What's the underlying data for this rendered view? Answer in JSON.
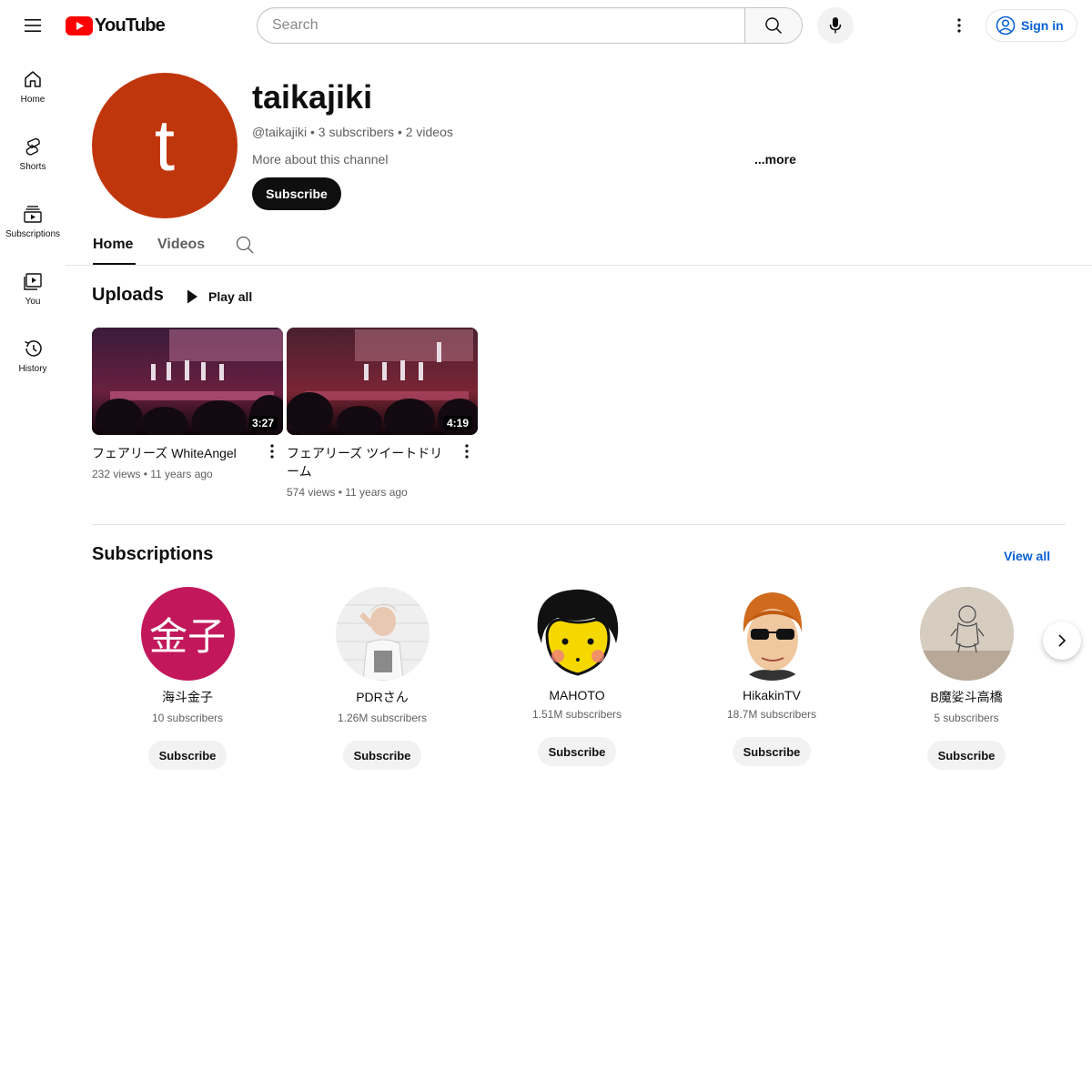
{
  "topbar": {
    "logo_text": "YouTube",
    "search_placeholder": "Search",
    "signin_label": "Sign in"
  },
  "sidebar": {
    "items": [
      {
        "label": "Home",
        "icon": "home-icon"
      },
      {
        "label": "Shorts",
        "icon": "shorts-icon"
      },
      {
        "label": "Subscriptions",
        "icon": "subscriptions-icon"
      },
      {
        "label": "You",
        "icon": "you-icon"
      },
      {
        "label": "History",
        "icon": "history-icon"
      }
    ]
  },
  "channel": {
    "avatar_letter": "t",
    "avatar_color": "#c0360c",
    "name": "taikajiki",
    "meta": "@taikajiki • 3 subscribers • 2 videos",
    "about": "More about this channel",
    "more": "...more",
    "subscribe_label": "Subscribe"
  },
  "tabs": {
    "home": "Home",
    "videos": "Videos"
  },
  "uploads": {
    "title": "Uploads",
    "play_all": "Play all",
    "videos": [
      {
        "title": "フェアリーズ WhiteAngel",
        "meta": "232 views • 11 years ago",
        "duration": "3:27"
      },
      {
        "title": "フェアリーズ ツイートドリーム",
        "meta": "574 views • 11 years ago",
        "duration": "4:19"
      }
    ]
  },
  "subscriptions": {
    "title": "Subscriptions",
    "view_all": "View all",
    "items": [
      {
        "name": "海斗金子",
        "count": "10 subscribers",
        "button": "Subscribe",
        "avatar_text": "金子"
      },
      {
        "name": "PDRさん",
        "count": "1.26M subscribers",
        "button": "Subscribe"
      },
      {
        "name": "MAHOTO",
        "count": "1.51M subscribers",
        "button": "Subscribe"
      },
      {
        "name": "HikakinTV",
        "count": "18.7M subscribers",
        "button": "Subscribe"
      },
      {
        "name": "B魔娑斗高橋",
        "count": "5 subscribers",
        "button": "Subscribe"
      }
    ]
  }
}
